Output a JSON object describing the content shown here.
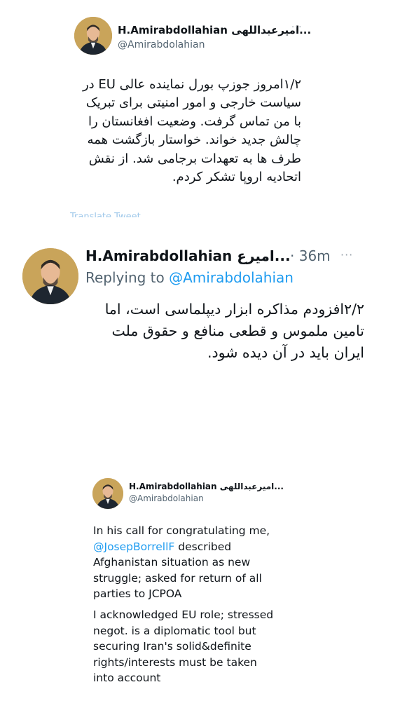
{
  "tweet1": {
    "name": "H.Amirabdollahian",
    "name_suffix": "...امیرعبداللهی",
    "handle": "@Amirabdolahian",
    "more": "···",
    "text": "۱/۲امروز جوزپ بورل نماینده عالی EU در\nسیاست خارجی و امور امنیتی برای تبریک\nبا من تماس گرفت. وضعیت افغانستان را\nچالش جدید خواند. خواستار بازگشت همه\nطرف ها به تعهدات برجامی شد. از نقش\nاتحادیه اروپا تشکر کردم.",
    "translate_link": "Translate Tweet"
  },
  "tweet2": {
    "name": "H.Amirabdollahian",
    "name_suffix": "...امیرع",
    "time": "· 36m",
    "more": "···",
    "replying_prefix": "Replying to",
    "replying_handle": "@Amirabdolahian",
    "text": "۲/۲افزودم مذاکره ابزار دیپلماسی است، اما\nتامین ملموس و قطعی منافع و حقوق ملت\nایران باید در آن دیده شود."
  },
  "tweet3": {
    "name": "H.Amirabdollahian",
    "name_suffix": "...امیرعبداللهی",
    "handle": "@Amirabdolahian",
    "para1_prefix": "In his call for congratulating me,",
    "para1_mention": "@JosepBorrellF",
    "para1_rest": " described\nAfghanistan situation as new\nstruggle; asked for return of all\nparties to JCPOA",
    "para2": "I acknowledged EU role; stressed\nnegot. is a diplomatic tool but\nsecuring Iran's solid&definite\nrights/interests must be taken\ninto account"
  }
}
